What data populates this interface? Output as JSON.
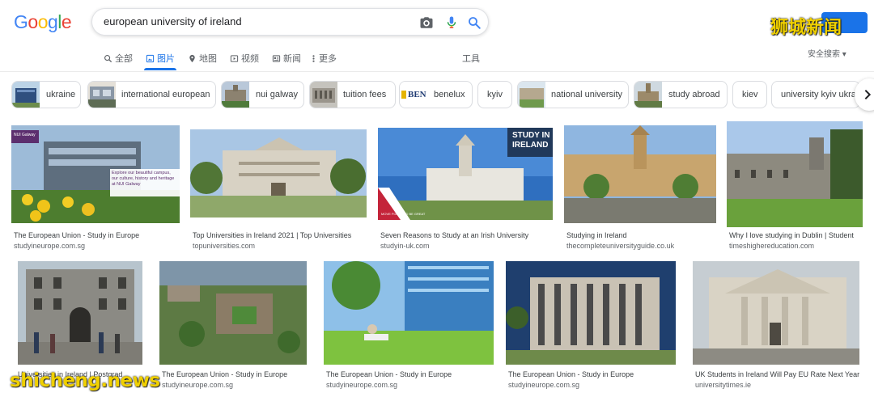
{
  "logo": {
    "letters": [
      "G",
      "o",
      "o",
      "g",
      "l",
      "e"
    ],
    "colors": [
      "#4285f4",
      "#ea4335",
      "#fbbc05",
      "#4285f4",
      "#34a853",
      "#ea4335"
    ]
  },
  "search": {
    "value": "european university of ireland"
  },
  "watermark_top": "狮城新闻",
  "watermark_bottom": "shicheng.news",
  "tabs": [
    {
      "label": "全部",
      "icon": "search-icon"
    },
    {
      "label": "图片",
      "icon": "image-icon",
      "active": true
    },
    {
      "label": "地图",
      "icon": "map-pin-icon"
    },
    {
      "label": "视频",
      "icon": "video-icon"
    },
    {
      "label": "新闻",
      "icon": "news-icon"
    },
    {
      "label": "更多",
      "icon": "more-icon"
    }
  ],
  "tools_label": "工具",
  "safe_search_label": "安全搜索",
  "chips": [
    {
      "label": "ukraine"
    },
    {
      "label": "international european"
    },
    {
      "label": "nui galway"
    },
    {
      "label": "tuition fees"
    },
    {
      "label": "benelux",
      "thumb_text": "BEN"
    },
    {
      "label": "kyiv"
    },
    {
      "label": "national university"
    },
    {
      "label": "study abroad"
    },
    {
      "label": "kiev"
    },
    {
      "label": "university kyiv ukrai"
    }
  ],
  "results": [
    {
      "caption": "The European Union - Study in Europe",
      "source": "studyineurope.com.sg",
      "overlay": "Explore our beautiful campus, our culture, history and heritage at NUI Galway",
      "badge": "NUI Galway"
    },
    {
      "caption": "Top Universities in Ireland 2021 | Top Universities",
      "source": "topuniversities.com"
    },
    {
      "caption": "Seven Reasons to Study at an Irish University",
      "source": "studyin-uk.com",
      "overlay": "STUDY IN IRELAND",
      "badge": "MOVE FORWARD BE GREAT"
    },
    {
      "caption": "Studying in Ireland",
      "source": "thecompleteuniversityguide.co.uk"
    },
    {
      "caption": "Why I love studying in Dublin | Student",
      "source": "timeshighereducation.com"
    },
    {
      "caption": "Universities in Ireland | Postgrad",
      "source": ""
    },
    {
      "caption": "The European Union - Study in Europe",
      "source": "studyineurope.com.sg"
    },
    {
      "caption": "The European Union - Study in Europe",
      "source": "studyineurope.com.sg"
    },
    {
      "caption": "The European Union - Study in Europe",
      "source": "studyineurope.com.sg"
    },
    {
      "caption": "UK Students in Ireland Will Pay EU Rate Next Year,",
      "source": "universitytimes.ie"
    }
  ]
}
